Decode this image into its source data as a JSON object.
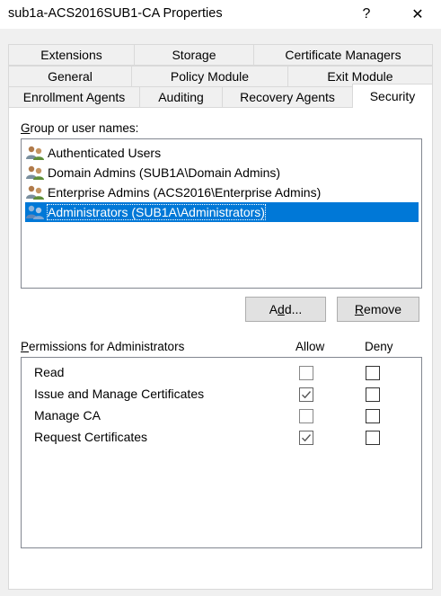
{
  "window": {
    "title": "sub1a-ACS2016SUB1-CA Properties",
    "help_glyph": "?",
    "close_glyph": "✕"
  },
  "tabs": {
    "row1": [
      {
        "label": "Extensions"
      },
      {
        "label": "Storage"
      },
      {
        "label": "Certificate Managers"
      }
    ],
    "row2": [
      {
        "label": "General"
      },
      {
        "label": "Policy Module"
      },
      {
        "label": "Exit Module"
      }
    ],
    "row3": [
      {
        "label": "Enrollment Agents"
      },
      {
        "label": "Auditing"
      },
      {
        "label": "Recovery Agents"
      },
      {
        "label": "Security",
        "active": true
      }
    ]
  },
  "groups": {
    "label_underlined": "G",
    "label_rest": "roup or user names:",
    "items": [
      {
        "name": "Authenticated Users",
        "icon": "users-icon"
      },
      {
        "name": "Domain Admins (SUB1A\\Domain Admins)",
        "icon": "users-icon"
      },
      {
        "name": "Enterprise Admins (ACS2016\\Enterprise Admins)",
        "icon": "users-icon"
      },
      {
        "name": "Administrators (SUB1A\\Administrators)",
        "icon": "users-icon",
        "selected": true
      }
    ]
  },
  "buttons": {
    "add_pre": "A",
    "add_underlined": "d",
    "add_post": "d...",
    "remove_underlined": "R",
    "remove_post": "emove"
  },
  "permissions": {
    "label_underlined": "P",
    "label_rest": "ermissions for Administrators",
    "allow_header": "Allow",
    "deny_header": "Deny",
    "rows": [
      {
        "name": "Read",
        "allow": false,
        "deny": false
      },
      {
        "name": "Issue and Manage Certificates",
        "allow": true,
        "deny": false
      },
      {
        "name": "Manage CA",
        "allow": false,
        "deny": false
      },
      {
        "name": "Request Certificates",
        "allow": true,
        "deny": false
      }
    ]
  },
  "colors": {
    "selection": "#0078d7",
    "panel": "#ffffff",
    "dialog": "#f0f0f0"
  }
}
